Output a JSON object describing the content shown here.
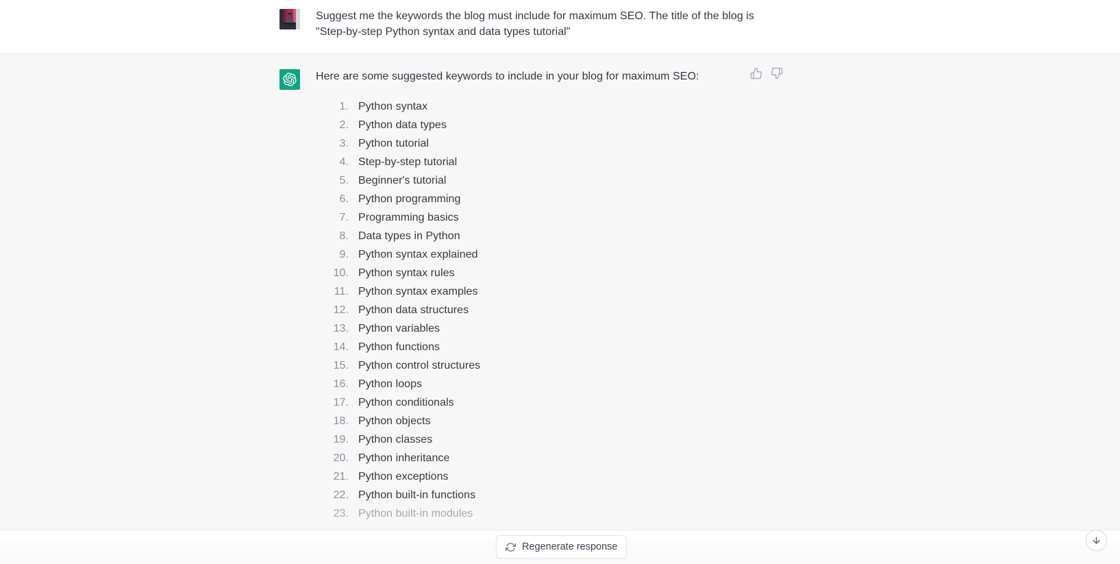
{
  "theme": {
    "user_bg": "#ffffff",
    "assistant_bg": "#f7f7f8",
    "brand_green": "#10a37f",
    "text_color": "#343541",
    "muted_color": "#8e8ea0",
    "divider": "#ececf1"
  },
  "conversation": {
    "user_message": {
      "avatar_name": "user-avatar-photo",
      "text_line_1": "Suggest me the keywords the blog must include for maximum SEO. The title of the blog is",
      "text_line_2": "\"Step-by-step Python syntax and data types tutorial\""
    },
    "assistant_message": {
      "avatar_name": "chatgpt-logo",
      "intro": "Here are some suggested keywords to include in your blog for maximum SEO:",
      "keywords": [
        "Python syntax",
        "Python data types",
        "Python tutorial",
        "Step-by-step tutorial",
        "Beginner's tutorial",
        "Python programming",
        "Programming basics",
        "Data types in Python",
        "Python syntax explained",
        "Python syntax rules",
        "Python syntax examples",
        "Python data structures",
        "Python variables",
        "Python functions",
        "Python control structures",
        "Python loops",
        "Python conditionals",
        "Python objects",
        "Python classes",
        "Python inheritance",
        "Python exceptions",
        "Python built-in functions",
        "Python built-in modules"
      ],
      "feedback": {
        "thumbs_up_label": "Good response",
        "thumbs_down_label": "Bad response"
      }
    }
  },
  "actions": {
    "regenerate_label": "Regenerate response",
    "regenerate_icon": "refresh-icon",
    "scroll_bottom_icon": "arrow-down-icon"
  }
}
